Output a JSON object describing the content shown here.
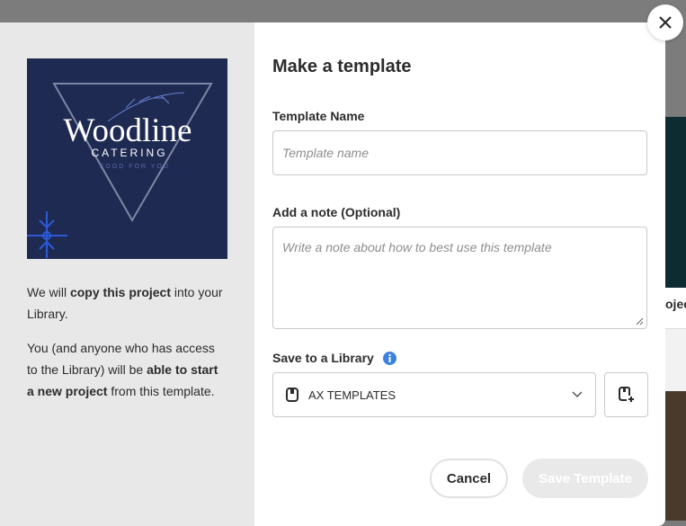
{
  "background": {
    "partial_text": "ojec"
  },
  "preview": {
    "logo_title": "Woodline",
    "logo_sub": "CATERING",
    "logo_tag": "FOOD FOR YOU"
  },
  "info": {
    "p1_a": "We will ",
    "p1_b": "copy this project",
    "p1_c": " into your Library.",
    "p2_a": "You (and anyone who has access to the Library) will be ",
    "p2_b": "able to start a new project",
    "p2_c": " from this template."
  },
  "form": {
    "title": "Make a template",
    "name_label": "Template Name",
    "name_placeholder": "Template name",
    "note_label": "Add a note (Optional)",
    "note_placeholder": "Write a note about how to best use this template",
    "library_label": "Save to a Library",
    "library_value": "AX TEMPLATES",
    "cancel": "Cancel",
    "save": "Save Template"
  },
  "colors": {
    "info": "#3b82e0",
    "thumb": "#1e2a52"
  }
}
